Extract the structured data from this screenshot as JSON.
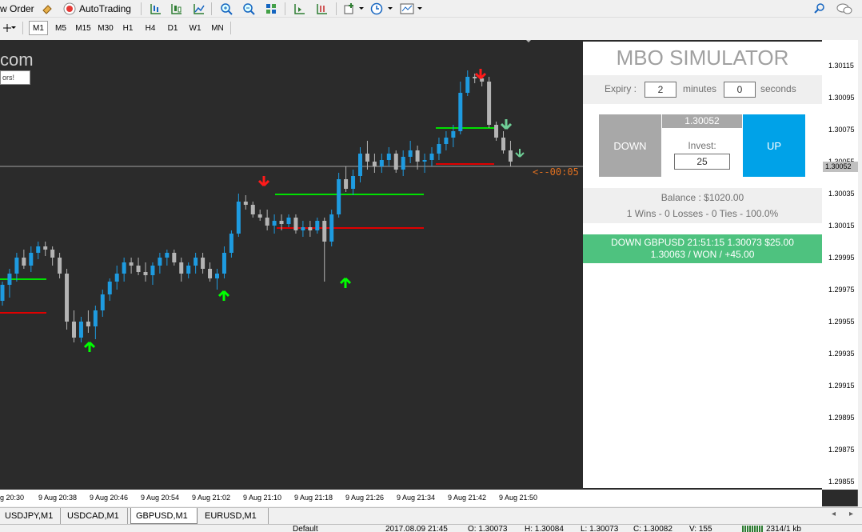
{
  "toolbar": {
    "new_order": "w Order",
    "autotrading": "AutoTrading"
  },
  "timeframes": [
    "M1",
    "M5",
    "M15",
    "M30",
    "H1",
    "H4",
    "D1",
    "W1",
    "MN"
  ],
  "chart": {
    "watermark": "com",
    "watermark_note": "ors!",
    "countdown": "<--00:05",
    "price_labels": [
      "1.30115",
      "1.30095",
      "1.30075",
      "1.30055",
      "1.30035",
      "1.30015",
      "1.29995",
      "1.29975",
      "1.29955",
      "1.29935",
      "1.29915",
      "1.29895",
      "1.29875",
      "1.29855"
    ],
    "current_price": "1.30052",
    "time_labels": [
      "g 20:30",
      "9 Aug 20:38",
      "9 Aug 20:46",
      "9 Aug 20:54",
      "9 Aug 21:02",
      "9 Aug 21:10",
      "9 Aug 21:18",
      "9 Aug 21:26",
      "9 Aug 21:34",
      "9 Aug 21:42",
      "9 Aug 21:50"
    ],
    "colors": {
      "bull": "#1e9be0",
      "bear": "#b4b4b4",
      "signal_up": "#00ff00",
      "signal_down": "#ff0000",
      "background": "#2b2b2b"
    }
  },
  "panel": {
    "title": "MBO SIMULATOR",
    "expiry_label": "Expiry :",
    "expiry_minutes": "2",
    "minutes_label": "minutes",
    "expiry_seconds": "0",
    "seconds_label": "seconds",
    "down_label": "DOWN",
    "up_label": "UP",
    "price": "1.30052",
    "invest_label": "Invest:",
    "invest_value": "25",
    "balance": "Balance : $1020.00",
    "stats": "1 Wins - 0 Losses - 0 Ties - 100.0%",
    "result_line1": "DOWN GBPUSD 21:51:15 1.30073 $25.00",
    "result_line2": "1.30063 / WON / +45.00"
  },
  "tabs": [
    "USDJPY,M1",
    "USDCAD,M1",
    "GBPUSD,M1",
    "EURUSD,M1"
  ],
  "active_tab": "GBPUSD,M1",
  "status": {
    "profile": "Default",
    "datetime": "2017.08.09 21:45",
    "open": "O: 1.30073",
    "high": "H: 1.30084",
    "low": "L: 1.30073",
    "close": "C: 1.30082",
    "volume": "V: 155",
    "traffic": "2314/1 kb"
  },
  "candles": [
    [
      1.29968,
      1.2998,
      1.29965,
      1.29978
    ],
    [
      1.29978,
      1.29988,
      1.2997,
      1.29985
    ],
    [
      1.29985,
      1.29998,
      1.2998,
      1.29995
    ],
    [
      1.29995,
      1.3,
      1.29988,
      1.2999
    ],
    [
      1.2999,
      1.30002,
      1.29986,
      1.29998
    ],
    [
      1.29998,
      1.30005,
      1.29994,
      1.30002
    ],
    [
      1.30002,
      1.30005,
      1.29996,
      1.3
    ],
    [
      1.3,
      1.30002,
      1.2999,
      1.29995
    ],
    [
      1.29995,
      1.29998,
      1.29982,
      1.29985
    ],
    [
      1.29985,
      1.29988,
      1.2995,
      1.29955
    ],
    [
      1.29955,
      1.29962,
      1.29942,
      1.29945
    ],
    [
      1.29945,
      1.29958,
      1.29942,
      1.29955
    ],
    [
      1.29955,
      1.29962,
      1.29948,
      1.29952
    ],
    [
      1.29952,
      1.29965,
      1.29944,
      1.29962
    ],
    [
      1.29962,
      1.29975,
      1.29958,
      1.29972
    ],
    [
      1.29972,
      1.29982,
      1.29968,
      1.2998
    ],
    [
      1.2998,
      1.2999,
      1.29975,
      1.29985
    ],
    [
      1.29985,
      1.29995,
      1.2998,
      1.29992
    ],
    [
      1.29992,
      1.29995,
      1.29985,
      1.2999
    ],
    [
      1.2999,
      1.29995,
      1.29984,
      1.29986
    ],
    [
      1.29986,
      1.29992,
      1.2998,
      1.29984
    ],
    [
      1.29984,
      1.29992,
      1.29978,
      1.2999
    ],
    [
      1.2999,
      1.29998,
      1.29985,
      1.29995
    ],
    [
      1.29995,
      1.3,
      1.2999,
      1.29998
    ],
    [
      1.29998,
      1.3,
      1.2999,
      1.29992
    ],
    [
      1.29992,
      1.29995,
      1.2998,
      1.29985
    ],
    [
      1.29985,
      1.29992,
      1.29982,
      1.2999
    ],
    [
      1.2999,
      1.29998,
      1.29985,
      1.29995
    ],
    [
      1.29995,
      1.29998,
      1.29985,
      1.29988
    ],
    [
      1.29988,
      1.29992,
      1.2998,
      1.29982
    ],
    [
      1.29982,
      1.29988,
      1.29975,
      1.29985
    ],
    [
      1.29985,
      1.30002,
      1.29982,
      1.29998
    ],
    [
      1.29998,
      1.30012,
      1.29995,
      1.3001
    ],
    [
      1.3001,
      1.30035,
      1.30008,
      1.3003
    ],
    [
      1.3003,
      1.30034,
      1.30025,
      1.30028
    ],
    [
      1.30028,
      1.3003,
      1.3002,
      1.30022
    ],
    [
      1.30022,
      1.30025,
      1.30018,
      1.3002
    ],
    [
      1.3002,
      1.30025,
      1.30012,
      1.30015
    ],
    [
      1.30015,
      1.30022,
      1.3001,
      1.30018
    ],
    [
      1.30018,
      1.30022,
      1.30012,
      1.30016
    ],
    [
      1.30016,
      1.30022,
      1.30014,
      1.3002
    ],
    [
      1.3002,
      1.30022,
      1.3001,
      1.30012
    ],
    [
      1.30012,
      1.30018,
      1.30008,
      1.30014
    ],
    [
      1.30014,
      1.30018,
      1.30008,
      1.30012
    ],
    [
      1.30012,
      1.3002,
      1.3001,
      1.30018
    ],
    [
      1.30018,
      1.3002,
      1.2998,
      1.30005
    ],
    [
      1.30005,
      1.30025,
      1.30002,
      1.30022
    ],
    [
      1.30022,
      1.30048,
      1.3002,
      1.30044
    ],
    [
      1.30044,
      1.30052,
      1.30036,
      1.30038
    ],
    [
      1.30038,
      1.3005,
      1.30034,
      1.30046
    ],
    [
      1.30046,
      1.30064,
      1.30042,
      1.3006
    ],
    [
      1.3006,
      1.30068,
      1.3005,
      1.30055
    ],
    [
      1.30055,
      1.3006,
      1.30048,
      1.30052
    ],
    [
      1.30052,
      1.3006,
      1.30048,
      1.30056
    ],
    [
      1.30056,
      1.30064,
      1.30052,
      1.3006
    ],
    [
      1.3006,
      1.30062,
      1.30048,
      1.3005
    ],
    [
      1.3005,
      1.30062,
      1.30046,
      1.30058
    ],
    [
      1.30058,
      1.30068,
      1.30054,
      1.30062
    ],
    [
      1.30062,
      1.30065,
      1.3005,
      1.30055
    ],
    [
      1.30055,
      1.3006,
      1.30048,
      1.30056
    ],
    [
      1.30056,
      1.30064,
      1.30052,
      1.3006
    ],
    [
      1.3006,
      1.3007,
      1.30056,
      1.30066
    ],
    [
      1.30066,
      1.30074,
      1.30062,
      1.3007
    ],
    [
      1.3007,
      1.30078,
      1.30064,
      1.30074
    ],
    [
      1.30074,
      1.30105,
      1.30072,
      1.30098
    ],
    [
      1.30098,
      1.30112,
      1.30096,
      1.30108
    ],
    [
      1.30108,
      1.3011,
      1.30104,
      1.30107
    ],
    [
      1.30107,
      1.30108,
      1.30102,
      1.30105
    ],
    [
      1.30105,
      1.30108,
      1.30076,
      1.30078
    ],
    [
      1.30078,
      1.3008,
      1.30068,
      1.3007
    ],
    [
      1.3007,
      1.30074,
      1.3006,
      1.30062
    ],
    [
      1.30062,
      1.30068,
      1.30052,
      1.30055
    ]
  ]
}
